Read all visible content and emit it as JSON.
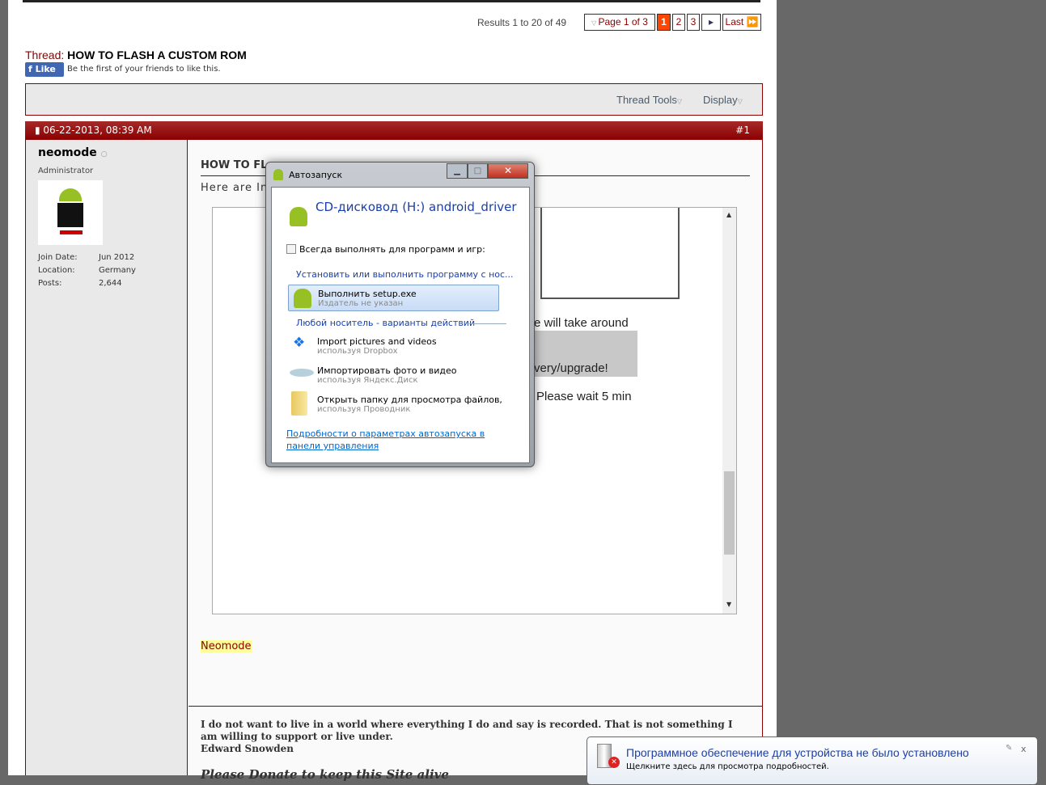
{
  "pagination": {
    "results": "Results 1 to 20 of 49",
    "page_label": "Page 1 of 3",
    "pages": [
      "1",
      "2",
      "3"
    ],
    "current": "1",
    "next_icon": "triangle-right",
    "last": "Last"
  },
  "thread": {
    "label": "Thread:",
    "title": "HOW TO FLASH A CUSTOM ROM",
    "like": "Like",
    "like_text": "Be the first of your friends to like this."
  },
  "toolbar": {
    "thread_tools": "Thread Tools",
    "display": "Display"
  },
  "post": {
    "date": "06-22-2013, 08:39 AM",
    "number": "#1",
    "title": "HOW TO FL",
    "intro": "Here are Ins",
    "fragments": [
      "e will take around",
      "very/upgrade!",
      "Please wait 5 min"
    ],
    "signature_name": "Neomode",
    "quote": "I do not want to live in a world where everything I do and say is recorded. That is not something I am willing to support or live under.",
    "quote_author": "Edward Snowden",
    "donate": "Please Donate to keep this Site alive"
  },
  "user": {
    "name": "neomode",
    "role": "Administrator",
    "join_label": "Join Date:",
    "join": "Jun 2012",
    "location_label": "Location:",
    "location": "Germany",
    "posts_label": "Posts:",
    "posts": "2,644"
  },
  "dialog": {
    "title": "Автозапуск",
    "drive": "CD-дисковод (H:) android_driver",
    "always": "Всегда выполнять для программ и игр:",
    "section1": "Установить или выполнить программу с нос...",
    "run": "Выполнить setup.exe",
    "run_sub": "Издатель не указан",
    "section2": "Любой носитель - варианты действий",
    "options": [
      {
        "label": "Import pictures and videos",
        "sub": "используя Dropbox"
      },
      {
        "label": "Импортировать фото и видео",
        "sub": "используя Яндекс.Диск"
      },
      {
        "label": "Открыть папку для просмотра файлов,",
        "sub": "используя Проводник"
      }
    ],
    "link": "Подробности о параметрах автозапуска в панели управления"
  },
  "notification": {
    "title": "Программное обеспечение для устройства не было установлено",
    "sub": "Щелкните здесь для просмотра подробностей."
  },
  "colors": {
    "accent": "#8b0000",
    "current_page": "#ff4500",
    "link": "#0066cc",
    "highlight": "#ffff99"
  }
}
